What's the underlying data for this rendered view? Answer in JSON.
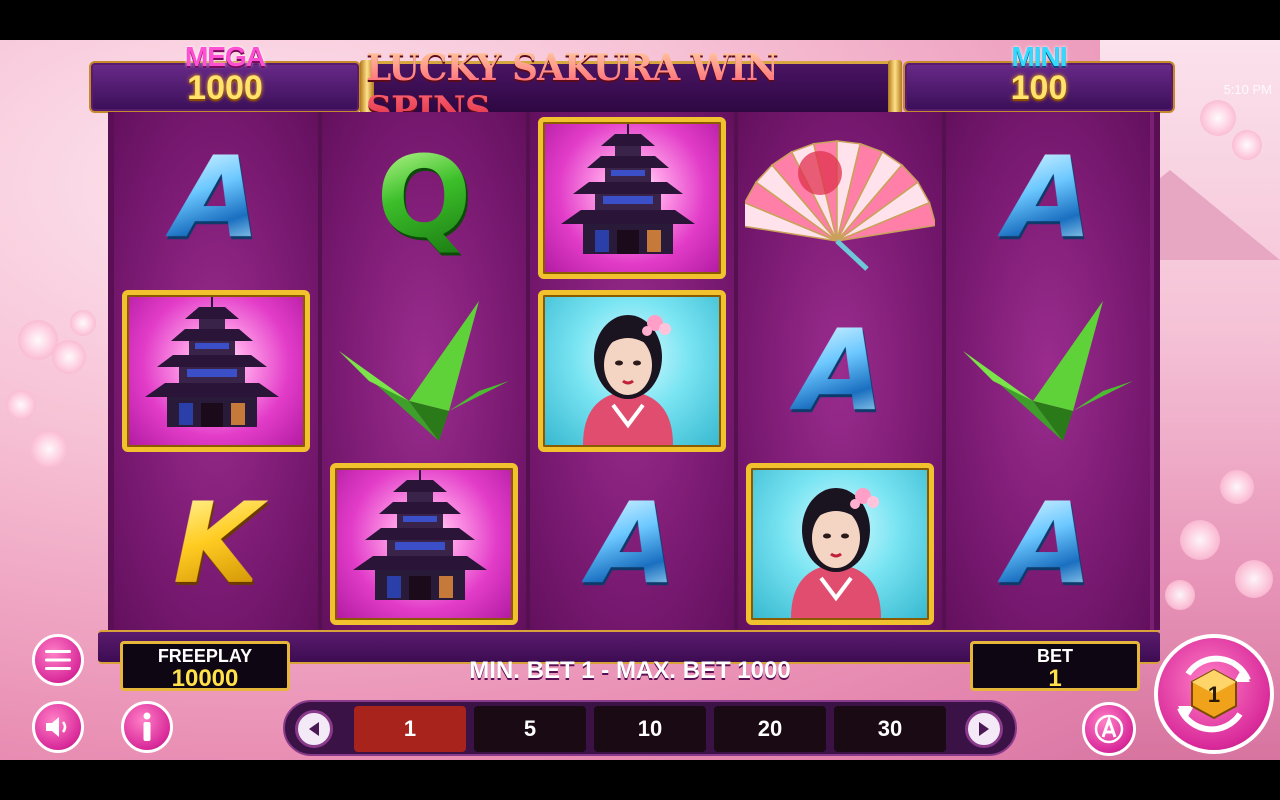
{
  "status_bar": {
    "time": "5:10 PM"
  },
  "jackpots": {
    "mega": {
      "label": "MEGA",
      "value": "1000"
    },
    "mini": {
      "label": "MINI",
      "value": "100"
    }
  },
  "title": "LUCKY SAKURA WIN SPINS",
  "reels": [
    [
      "A",
      "pagoda",
      "K"
    ],
    [
      "Q",
      "crane",
      "pagoda"
    ],
    [
      "pagoda",
      "geisha",
      "A"
    ],
    [
      "fan",
      "A",
      "geisha"
    ],
    [
      "A",
      "crane",
      "A"
    ]
  ],
  "freeplay": {
    "label": "FREEPLAY",
    "value": "10000"
  },
  "bet": {
    "label": "BET",
    "value": "1"
  },
  "bet_range": "MIN. BET 1 - MAX. BET 1000",
  "bet_options": [
    "1",
    "5",
    "10",
    "20",
    "30"
  ],
  "selected_bet": "1",
  "spin_counter": "1",
  "icons": {
    "menu": "hamburger-menu-icon",
    "sound": "speaker-icon",
    "info": "info-icon",
    "prev": "chevron-left-icon",
    "next": "chevron-right-icon",
    "autoplay": "autoplay-icon",
    "spin": "spin-icon"
  },
  "colors": {
    "reel_bg": "#7a1f74",
    "gold_border": "#e6b63a",
    "selected_bet": "#a8231c"
  }
}
